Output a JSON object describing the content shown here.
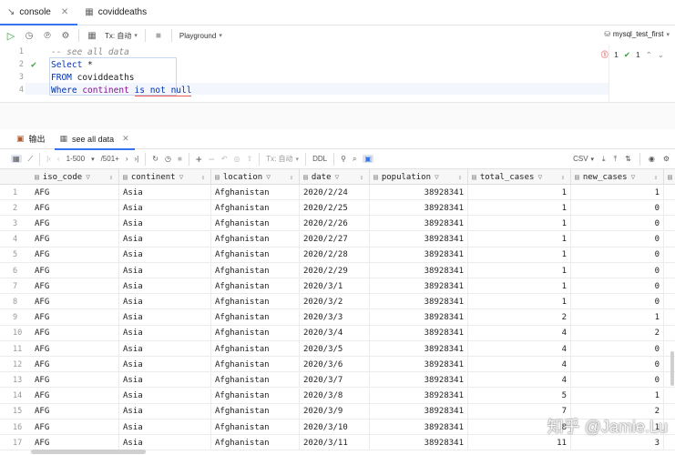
{
  "tabs": [
    {
      "label": "console",
      "icon": "console-icon",
      "active": true
    },
    {
      "label": "coviddeaths",
      "icon": "table-icon",
      "active": false
    }
  ],
  "toolbar": {
    "tx_label": "Tx: 自动",
    "playground_label": "Playground",
    "connection_label": "mysql_test_first"
  },
  "editor": {
    "line_numbers": [
      "1",
      "2",
      "3",
      "4"
    ],
    "comment": "-- see all data",
    "line2_kw": "Select",
    "line2_rest": " *",
    "line3_kw": "FROM",
    "line3_rest": " coviddeaths",
    "line4_kw1": "Where",
    "line4_mid": " continent ",
    "line4_kw2": "is not null",
    "error_count": "1",
    "ok_count": "1"
  },
  "result_tabs": {
    "output_label": "输出",
    "data_label": "see all data"
  },
  "grid_toolbar": {
    "range": "1-500",
    "total": "/501+",
    "tx_label": "Tx: 自动",
    "ddl_label": "DDL",
    "format_label": "CSV"
  },
  "grid": {
    "columns": [
      "iso_code",
      "continent",
      "location",
      "date",
      "population",
      "total_cases",
      "new_cases"
    ],
    "rows": [
      [
        "1",
        "AFG",
        "Asia",
        "Afghanistan",
        "2020/2/24",
        "38928341",
        "1",
        "1"
      ],
      [
        "2",
        "AFG",
        "Asia",
        "Afghanistan",
        "2020/2/25",
        "38928341",
        "1",
        "0"
      ],
      [
        "3",
        "AFG",
        "Asia",
        "Afghanistan",
        "2020/2/26",
        "38928341",
        "1",
        "0"
      ],
      [
        "4",
        "AFG",
        "Asia",
        "Afghanistan",
        "2020/2/27",
        "38928341",
        "1",
        "0"
      ],
      [
        "5",
        "AFG",
        "Asia",
        "Afghanistan",
        "2020/2/28",
        "38928341",
        "1",
        "0"
      ],
      [
        "6",
        "AFG",
        "Asia",
        "Afghanistan",
        "2020/2/29",
        "38928341",
        "1",
        "0"
      ],
      [
        "7",
        "AFG",
        "Asia",
        "Afghanistan",
        "2020/3/1",
        "38928341",
        "1",
        "0"
      ],
      [
        "8",
        "AFG",
        "Asia",
        "Afghanistan",
        "2020/3/2",
        "38928341",
        "1",
        "0"
      ],
      [
        "9",
        "AFG",
        "Asia",
        "Afghanistan",
        "2020/3/3",
        "38928341",
        "2",
        "1"
      ],
      [
        "10",
        "AFG",
        "Asia",
        "Afghanistan",
        "2020/3/4",
        "38928341",
        "4",
        "2"
      ],
      [
        "11",
        "AFG",
        "Asia",
        "Afghanistan",
        "2020/3/5",
        "38928341",
        "4",
        "0"
      ],
      [
        "12",
        "AFG",
        "Asia",
        "Afghanistan",
        "2020/3/6",
        "38928341",
        "4",
        "0"
      ],
      [
        "13",
        "AFG",
        "Asia",
        "Afghanistan",
        "2020/3/7",
        "38928341",
        "4",
        "0"
      ],
      [
        "14",
        "AFG",
        "Asia",
        "Afghanistan",
        "2020/3/8",
        "38928341",
        "5",
        "1"
      ],
      [
        "15",
        "AFG",
        "Asia",
        "Afghanistan",
        "2020/3/9",
        "38928341",
        "7",
        "2"
      ],
      [
        "16",
        "AFG",
        "Asia",
        "Afghanistan",
        "2020/3/10",
        "38928341",
        "8",
        "1"
      ],
      [
        "17",
        "AFG",
        "Asia",
        "Afghanistan",
        "2020/3/11",
        "38928341",
        "11",
        "3"
      ]
    ]
  },
  "watermark": "知乎 @Jamie.Lu"
}
